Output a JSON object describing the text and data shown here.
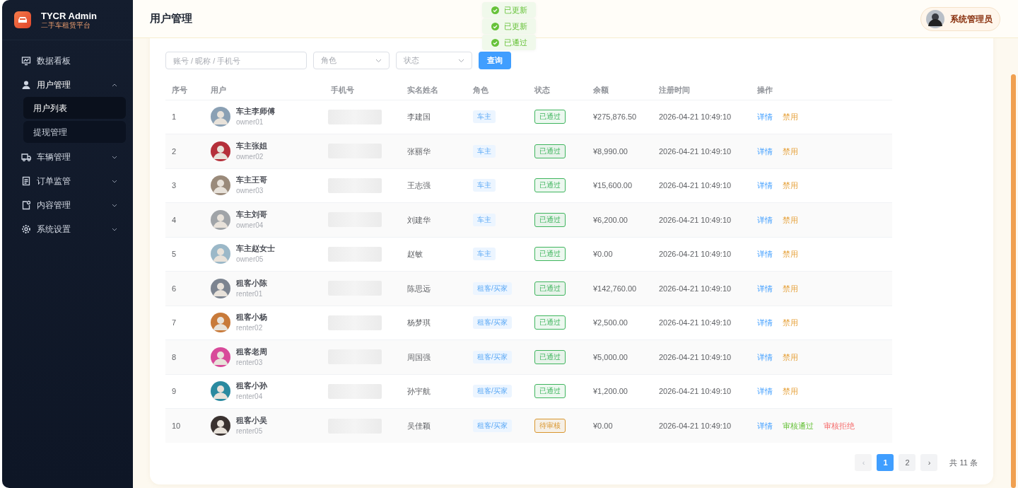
{
  "brand": {
    "title": "TYCR Admin",
    "subtitle": "二手车租赁平台"
  },
  "sidebar": {
    "items": [
      {
        "label": "数据看板"
      },
      {
        "label": "用户管理",
        "expanded": true,
        "children": [
          {
            "label": "用户列表",
            "selected": true
          },
          {
            "label": "提现管理",
            "selected": false
          }
        ]
      },
      {
        "label": "车辆管理",
        "expanded": false
      },
      {
        "label": "订单监管",
        "expanded": false
      },
      {
        "label": "内容管理",
        "expanded": false
      },
      {
        "label": "系统设置",
        "expanded": false
      }
    ]
  },
  "header": {
    "title": "用户管理",
    "user": "系统管理员"
  },
  "toasts": [
    "已更新",
    "已更新",
    "已通过"
  ],
  "filters": {
    "search_placeholder": "账号 / 昵称 / 手机号",
    "role_placeholder": "角色",
    "status_placeholder": "状态",
    "query_button": "查询"
  },
  "table": {
    "columns": [
      "序号",
      "用户",
      "手机号",
      "实名姓名",
      "角色",
      "状态",
      "余额",
      "注册时间",
      "操作"
    ],
    "rows": [
      {
        "index": "1",
        "name": "车主李师傅",
        "account": "owner01",
        "real_name": "李建国",
        "role": "车主",
        "status": {
          "label": "已通过",
          "color": "#3fb55e"
        },
        "balance": "¥275,876.50",
        "registered": "2026-04-21 10:49:10",
        "actions": [
          {
            "label": "详情",
            "kind": "detail"
          },
          {
            "label": "禁用",
            "kind": "disable"
          }
        ]
      },
      {
        "index": "2",
        "name": "车主张姐",
        "account": "owner02",
        "real_name": "张丽华",
        "role": "车主",
        "status": {
          "label": "已通过",
          "color": "#3fb55e"
        },
        "balance": "¥8,990.00",
        "registered": "2026-04-21 10:49:10",
        "actions": [
          {
            "label": "详情",
            "kind": "detail"
          },
          {
            "label": "禁用",
            "kind": "disable"
          }
        ]
      },
      {
        "index": "3",
        "name": "车主王哥",
        "account": "owner03",
        "real_name": "王志强",
        "role": "车主",
        "status": {
          "label": "已通过",
          "color": "#3fb55e"
        },
        "balance": "¥15,600.00",
        "registered": "2026-04-21 10:49:10",
        "actions": [
          {
            "label": "详情",
            "kind": "detail"
          },
          {
            "label": "禁用",
            "kind": "disable"
          }
        ]
      },
      {
        "index": "4",
        "name": "车主刘哥",
        "account": "owner04",
        "real_name": "刘建华",
        "role": "车主",
        "status": {
          "label": "已通过",
          "color": "#3fb55e"
        },
        "balance": "¥6,200.00",
        "registered": "2026-04-21 10:49:10",
        "actions": [
          {
            "label": "详情",
            "kind": "detail"
          },
          {
            "label": "禁用",
            "kind": "disable"
          }
        ]
      },
      {
        "index": "5",
        "name": "车主赵女士",
        "account": "owner05",
        "real_name": "赵敏",
        "role": "车主",
        "status": {
          "label": "已通过",
          "color": "#3fb55e"
        },
        "balance": "¥0.00",
        "registered": "2026-04-21 10:49:10",
        "actions": [
          {
            "label": "详情",
            "kind": "detail"
          },
          {
            "label": "禁用",
            "kind": "disable"
          }
        ]
      },
      {
        "index": "6",
        "name": "租客小陈",
        "account": "renter01",
        "real_name": "陈思远",
        "role": "租客/买家",
        "status": {
          "label": "已通过",
          "color": "#3fb55e"
        },
        "balance": "¥142,760.00",
        "registered": "2026-04-21 10:49:10",
        "actions": [
          {
            "label": "详情",
            "kind": "detail"
          },
          {
            "label": "禁用",
            "kind": "disable"
          }
        ]
      },
      {
        "index": "7",
        "name": "租客小杨",
        "account": "renter02",
        "real_name": "杨梦琪",
        "role": "租客/买家",
        "status": {
          "label": "已通过",
          "color": "#3fb55e"
        },
        "balance": "¥2,500.00",
        "registered": "2026-04-21 10:49:10",
        "actions": [
          {
            "label": "详情",
            "kind": "detail"
          },
          {
            "label": "禁用",
            "kind": "disable"
          }
        ]
      },
      {
        "index": "8",
        "name": "租客老周",
        "account": "renter03",
        "real_name": "周国强",
        "role": "租客/买家",
        "status": {
          "label": "已通过",
          "color": "#3fb55e"
        },
        "balance": "¥5,000.00",
        "registered": "2026-04-21 10:49:10",
        "actions": [
          {
            "label": "详情",
            "kind": "detail"
          },
          {
            "label": "禁用",
            "kind": "disable"
          }
        ]
      },
      {
        "index": "9",
        "name": "租客小孙",
        "account": "renter04",
        "real_name": "孙宇航",
        "role": "租客/买家",
        "status": {
          "label": "已通过",
          "color": "#3fb55e"
        },
        "balance": "¥1,200.00",
        "registered": "2026-04-21 10:49:10",
        "actions": [
          {
            "label": "详情",
            "kind": "detail"
          },
          {
            "label": "禁用",
            "kind": "disable"
          }
        ]
      },
      {
        "index": "10",
        "name": "租客小吴",
        "account": "renter05",
        "real_name": "吴佳颖",
        "role": "租客/买家",
        "status": {
          "label": "待审核",
          "color": "#d9962f"
        },
        "balance": "¥0.00",
        "registered": "2026-04-21 10:49:10",
        "actions": [
          {
            "label": "详情",
            "kind": "detail"
          },
          {
            "label": "审核通过",
            "kind": "approve"
          },
          {
            "label": "审核拒绝",
            "kind": "reject"
          }
        ]
      }
    ]
  },
  "pagination": {
    "prev": {
      "label": "‹",
      "disabled": true
    },
    "pages": [
      {
        "label": "1",
        "selected": true
      },
      {
        "label": "2",
        "selected": false
      }
    ],
    "next": {
      "label": "›",
      "disabled": false
    },
    "total": "共 11 条"
  }
}
